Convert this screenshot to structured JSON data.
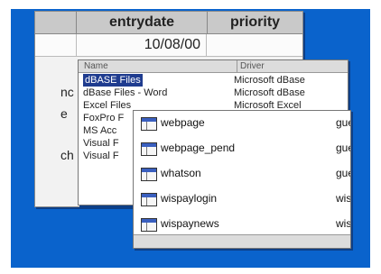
{
  "sheet": {
    "columns": [
      "entrydate",
      "priority"
    ],
    "row1": {
      "entrydate": "10/08/00"
    },
    "partial_left": [
      "nc",
      "e",
      "ch"
    ]
  },
  "drivers": {
    "header_name": "Name",
    "header_driver": "Driver",
    "rows": [
      {
        "name": "dBASE Files",
        "driver": "Microsoft dBase"
      },
      {
        "name": "dBase Files - Word",
        "driver": "Microsoft dBase"
      },
      {
        "name": "Excel Files",
        "driver": "Microsoft Excel"
      },
      {
        "name": "FoxPro F",
        "driver": ""
      },
      {
        "name": "MS Acc",
        "driver": ""
      },
      {
        "name": "Visual F",
        "driver": ""
      },
      {
        "name": "Visual F",
        "driver": ""
      }
    ]
  },
  "tables": {
    "items": [
      {
        "name": "webpage",
        "owner": "gue"
      },
      {
        "name": "webpage_pend",
        "owner": "gue"
      },
      {
        "name": "whatson",
        "owner": "gue"
      },
      {
        "name": "wispaylogin",
        "owner": "wisp"
      },
      {
        "name": "wispaynews",
        "owner": "wisp"
      }
    ]
  },
  "colors": {
    "background": "#0a63cc",
    "selection": "#1f3c8f"
  }
}
